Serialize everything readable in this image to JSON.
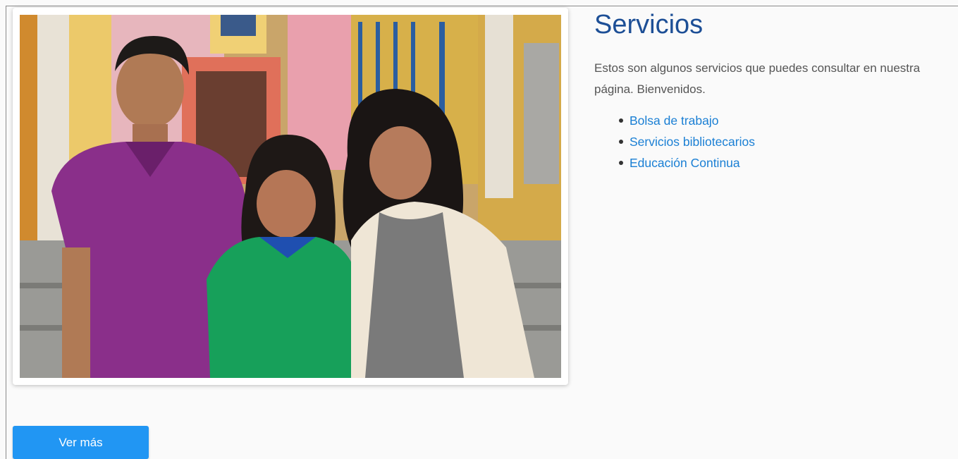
{
  "section": {
    "title": "Servicios",
    "description": "Estos son algunos servicios que puedes consultar en nuestra página. Bienvenidos.",
    "links": [
      {
        "label": "Bolsa de trabajo"
      },
      {
        "label": "Servicios bibliotecarios"
      },
      {
        "label": "Educación Continua"
      }
    ]
  },
  "photo": {
    "alt": "Tres estudiantes sonriendo"
  },
  "cta": {
    "label": "Ver más"
  },
  "colors": {
    "title": "#1d4f96",
    "link": "#1a7fd4",
    "button": "#2196f3"
  }
}
